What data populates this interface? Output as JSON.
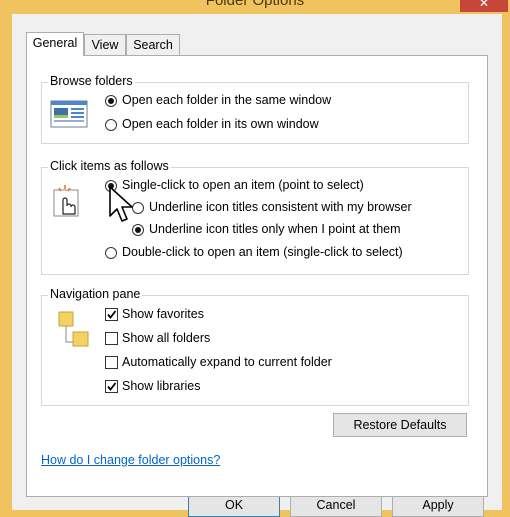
{
  "window": {
    "title": "Folder Options",
    "close_glyph": "✕"
  },
  "tabs": [
    {
      "label": "General"
    },
    {
      "label": "View"
    },
    {
      "label": "Search"
    }
  ],
  "browse_folders": {
    "legend": "Browse folders",
    "options": [
      {
        "label": "Open each folder in the same window",
        "selected": true
      },
      {
        "label": "Open each folder in its own window",
        "selected": false
      }
    ]
  },
  "click_items": {
    "legend": "Click items as follows",
    "options": [
      {
        "label": "Single-click to open an item (point to select)",
        "selected": true
      },
      {
        "label": "Underline icon titles consistent with my browser",
        "selected": false
      },
      {
        "label": "Underline icon titles only when I point at them",
        "selected": true
      },
      {
        "label": "Double-click to open an item (single-click to select)",
        "selected": false
      }
    ]
  },
  "navigation_pane": {
    "legend": "Navigation pane",
    "options": [
      {
        "label": "Show favorites",
        "checked": true
      },
      {
        "label": "Show all folders",
        "checked": false
      },
      {
        "label": "Automatically expand to current folder",
        "checked": false
      },
      {
        "label": "Show libraries",
        "checked": true
      }
    ]
  },
  "restore_defaults_label": "Restore Defaults",
  "help_link": "How do I change folder options?",
  "footer": {
    "ok_label": "OK",
    "cancel_label": "Cancel",
    "apply_label": "Apply"
  }
}
